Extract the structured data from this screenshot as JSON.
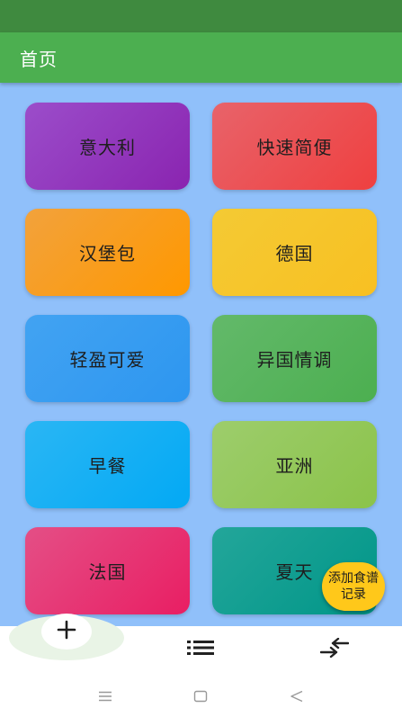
{
  "app_bar": {
    "title": "首页"
  },
  "categories": [
    {
      "label": "意大利",
      "gradient": [
        "#9b4dca",
        "#8a24b0"
      ]
    },
    {
      "label": "快速简便",
      "gradient": [
        "#e8636a",
        "#ef4040"
      ]
    },
    {
      "label": "汉堡包",
      "gradient": [
        "#f2a23c",
        "#ff9800"
      ]
    },
    {
      "label": "德国",
      "gradient": [
        "#f4ca34",
        "#f8c022"
      ]
    },
    {
      "label": "轻盈可爱",
      "gradient": [
        "#42a3f2",
        "#2d96f0"
      ]
    },
    {
      "label": "异国情调",
      "gradient": [
        "#63b96a",
        "#4caf50"
      ]
    },
    {
      "label": "早餐",
      "gradient": [
        "#2ab6f4",
        "#03a9f4"
      ]
    },
    {
      "label": "亚洲",
      "gradient": [
        "#9dcd6c",
        "#8bc34a"
      ]
    },
    {
      "label": "法国",
      "gradient": [
        "#e44f86",
        "#e91e63"
      ]
    },
    {
      "label": "夏天",
      "gradient": [
        "#23a69a",
        "#009688"
      ]
    }
  ],
  "fab": {
    "label": "添加食谱记录",
    "color": "#ffc81a"
  },
  "bottom_nav": {
    "items": [
      {
        "icon": "plus-icon"
      },
      {
        "icon": "list-icon"
      },
      {
        "icon": "swap-arrows-icon"
      }
    ]
  },
  "system_nav": {
    "icons": [
      "menu-icon",
      "home-icon",
      "back-icon"
    ]
  }
}
